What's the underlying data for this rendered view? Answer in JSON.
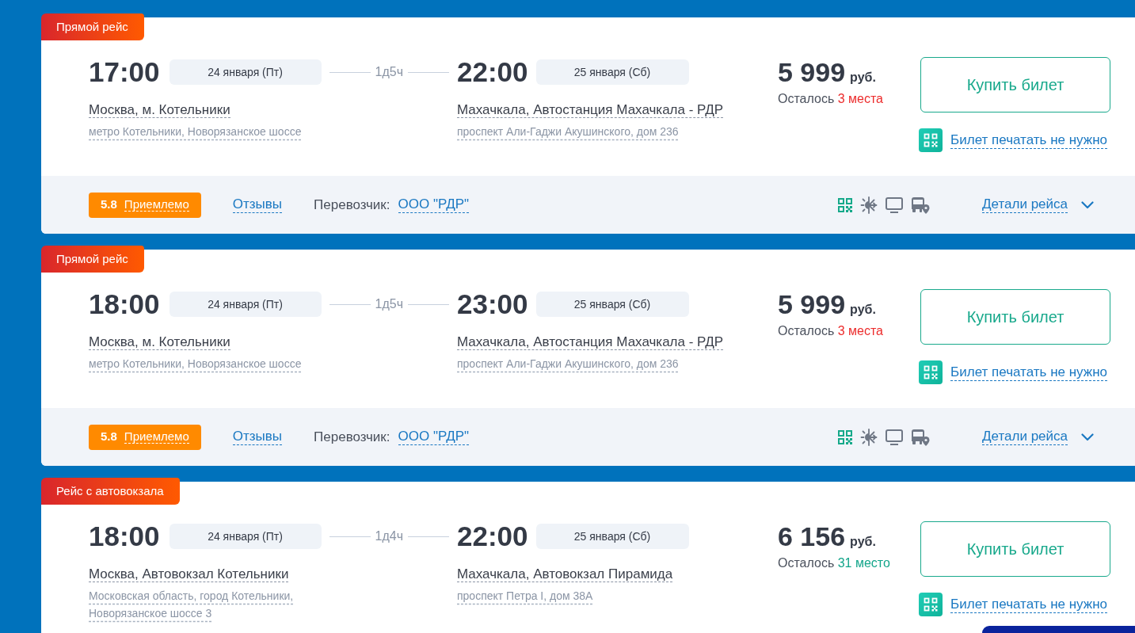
{
  "trips": [
    {
      "badge": "Прямой рейс",
      "departure": {
        "time": "17:00",
        "date": "24 января (Пт)",
        "city": "Москва, м. Котельники",
        "address": "метро Котельники, Новорязанское шоссе"
      },
      "duration": "1д5ч",
      "arrival": {
        "time": "22:00",
        "date": "25 января (Сб)",
        "city": "Махачкала, Автостанция Махачкала - РДР",
        "address": "проспект Али-Гаджи Акушинского, дом 236"
      },
      "price": "5 999",
      "currency": "руб.",
      "seats": {
        "label": "Осталось",
        "count": "3 места",
        "color": "#ec2b2b"
      },
      "buy_button": "Купить билет",
      "eticket_link": "Билет печатать не нужно",
      "rating": {
        "score": "5.8",
        "label": "Приемлемо"
      },
      "reviews_link": "Отзывы",
      "carrier_label": "Перевозчик:",
      "carrier": "ООО \"РДР\"",
      "details_link": "Детали рейса"
    },
    {
      "badge": "Прямой рейс",
      "departure": {
        "time": "18:00",
        "date": "24 января (Пт)",
        "city": "Москва, м. Котельники",
        "address": "метро Котельники, Новорязанское шоссе"
      },
      "duration": "1д5ч",
      "arrival": {
        "time": "23:00",
        "date": "25 января (Сб)",
        "city": "Махачкала, Автостанция Махачкала - РДР",
        "address": "проспект Али-Гаджи Акушинского, дом 236"
      },
      "price": "5 999",
      "currency": "руб.",
      "seats": {
        "label": "Осталось",
        "count": "3 места",
        "color": "#ec2b2b"
      },
      "buy_button": "Купить билет",
      "eticket_link": "Билет печатать не нужно",
      "rating": {
        "score": "5.8",
        "label": "Приемлемо"
      },
      "reviews_link": "Отзывы",
      "carrier_label": "Перевозчик:",
      "carrier": "ООО \"РДР\"",
      "details_link": "Детали рейса"
    },
    {
      "badge": "Рейс с автовокзала",
      "departure": {
        "time": "18:00",
        "date": "24 января (Пт)",
        "city": "Москва, Автовокзал Котельники",
        "address": "Московская область, город Котельники, Новорязанское шоссе 3"
      },
      "duration": "1д4ч",
      "arrival": {
        "time": "22:00",
        "date": "25 января (Сб)",
        "city": "Махачкала, Автовокзал Пирамида",
        "address": "проспект Петра I, дом 38А"
      },
      "price": "6 156",
      "currency": "руб.",
      "seats": {
        "label": "Осталось",
        "count": "31 место",
        "color": "#13a58a"
      },
      "buy_button": "Купить билет",
      "eticket_link": "Билет печатать не нужно"
    }
  ]
}
